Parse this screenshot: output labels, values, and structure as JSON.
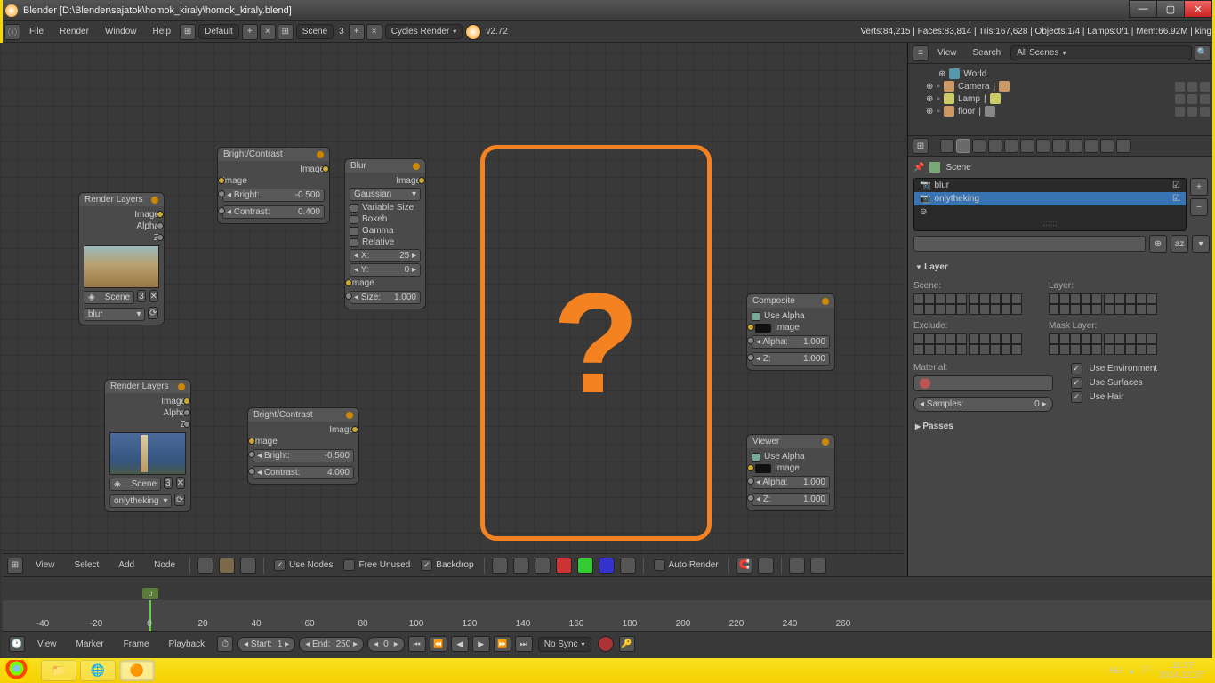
{
  "title": "Blender [D:\\Blender\\sajatok\\homok_kiraly\\homok_kiraly.blend]",
  "menubar": {
    "file": "File",
    "render": "Render",
    "window": "Window",
    "help": "Help",
    "layout": "Default",
    "scene": "Scene",
    "scene_num": "3",
    "engine": "Cycles Render",
    "version": "v2.72",
    "stats": "Verts:84,215 | Faces:83,814 | Tris:167,628 | Objects:1/4 | Lamps:0/1 | Mem:66.92M | king"
  },
  "nodes": {
    "rl1": {
      "title": "Render Layers",
      "out_image": "Image",
      "out_alpha": "Alpha",
      "out_z": "Z",
      "scene": "Scene",
      "num": "3",
      "layer": "blur"
    },
    "rl2": {
      "title": "Render Layers",
      "out_image": "Image",
      "out_alpha": "Alpha",
      "out_z": "Z",
      "scene": "Scene",
      "num": "3",
      "layer": "onlytheking"
    },
    "bc1": {
      "title": "Bright/Contrast",
      "out_image": "Image",
      "in_image": "Image",
      "bright_lbl": "Bright:",
      "bright": "-0.500",
      "contrast_lbl": "Contrast:",
      "contrast": "0.400"
    },
    "bc2": {
      "title": "Bright/Contrast",
      "out_image": "Image",
      "in_image": "Image",
      "bright_lbl": "Bright:",
      "bright": "-0.500",
      "contrast_lbl": "Contrast:",
      "contrast": "4.000"
    },
    "blur": {
      "title": "Blur",
      "out_image": "Image",
      "type": "Gaussian",
      "var": "Variable Size",
      "bokeh": "Bokeh",
      "gamma": "Gamma",
      "rel": "Relative",
      "x_lbl": "X:",
      "x": "25",
      "y_lbl": "Y:",
      "y": "0",
      "in_image": "Image",
      "size_lbl": "Size:",
      "size": "1.000"
    },
    "comp": {
      "title": "Composite",
      "alpha": "Use Alpha",
      "in_image": "Image",
      "alpha_lbl": "Alpha:",
      "alpha_v": "1.000",
      "z_lbl": "Z:",
      "z": "1.000"
    },
    "view": {
      "title": "Viewer",
      "alpha": "Use Alpha",
      "in_image": "Image",
      "alpha_lbl": "Alpha:",
      "alpha_v": "1.000",
      "z_lbl": "Z:",
      "z": "1.000"
    }
  },
  "scene_label": "Scene",
  "nodebar": {
    "view": "View",
    "select": "Select",
    "add": "Add",
    "node": "Node",
    "use_nodes": "Use Nodes",
    "free": "Free Unused",
    "backdrop": "Backdrop",
    "auto": "Auto Render"
  },
  "timeline": {
    "view": "View",
    "marker": "Marker",
    "frame": "Frame",
    "playback": "Playback",
    "start_lbl": "Start:",
    "start": "1",
    "end_lbl": "End:",
    "end": "250",
    "cur": "0",
    "sync": "No Sync",
    "ticks": [
      "-40",
      "-20",
      "0",
      "20",
      "40",
      "60",
      "80",
      "100",
      "120",
      "140",
      "160",
      "180",
      "200",
      "220",
      "240",
      "260"
    ]
  },
  "outliner": {
    "view": "View",
    "search": "Search",
    "filter": "All Scenes",
    "world": "World",
    "camera": "Camera",
    "lamp": "Lamp",
    "floor": "floor"
  },
  "props": {
    "crumb": "Scene",
    "layers": {
      "l1": "blur",
      "l2": "onlytheking"
    },
    "layer_hdr": "Layer",
    "scene_lbl": "Scene:",
    "layer_lbl": "Layer:",
    "exclude_lbl": "Exclude:",
    "mask_lbl": "Mask Layer:",
    "material_lbl": "Material:",
    "samples_lbl": "Samples:",
    "samples": "0",
    "use_env": "Use Environment",
    "use_surf": "Use Surfaces",
    "use_hair": "Use Hair",
    "passes": "Passes"
  },
  "taskbar": {
    "lang": "HU",
    "time": "11:17",
    "date": "2014.12.27."
  }
}
